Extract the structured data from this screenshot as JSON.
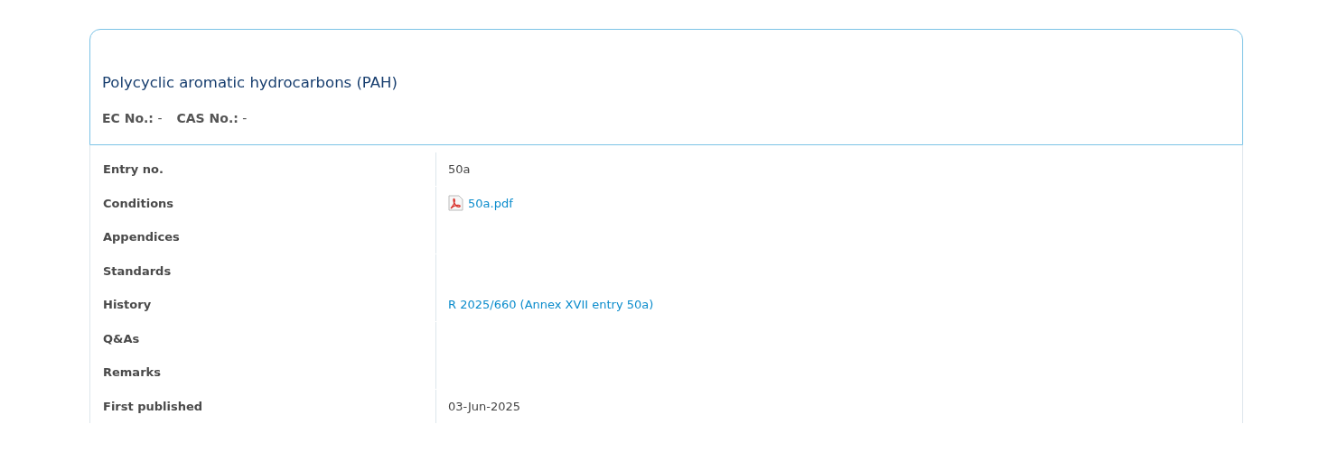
{
  "substance": {
    "name": "Polycyclic aromatic hydrocarbons (PAH)",
    "identifiers": [
      {
        "label": "EC No.:",
        "value": "-"
      },
      {
        "label": "CAS No.:",
        "value": "-"
      }
    ]
  },
  "details": [
    {
      "label": "Entry no.",
      "kind": "text",
      "value": "50a"
    },
    {
      "label": "Conditions",
      "kind": "file",
      "value": "50a.pdf"
    },
    {
      "label": "Appendices",
      "kind": "empty"
    },
    {
      "label": "Standards",
      "kind": "empty"
    },
    {
      "label": "History",
      "kind": "link",
      "value": "R 2025/660 (Annex XVII entry 50a)"
    },
    {
      "label": "Q&As",
      "kind": "empty"
    },
    {
      "label": "Remarks",
      "kind": "empty"
    },
    {
      "label": "First published",
      "kind": "text",
      "value": "03-Jun-2025"
    }
  ]
}
